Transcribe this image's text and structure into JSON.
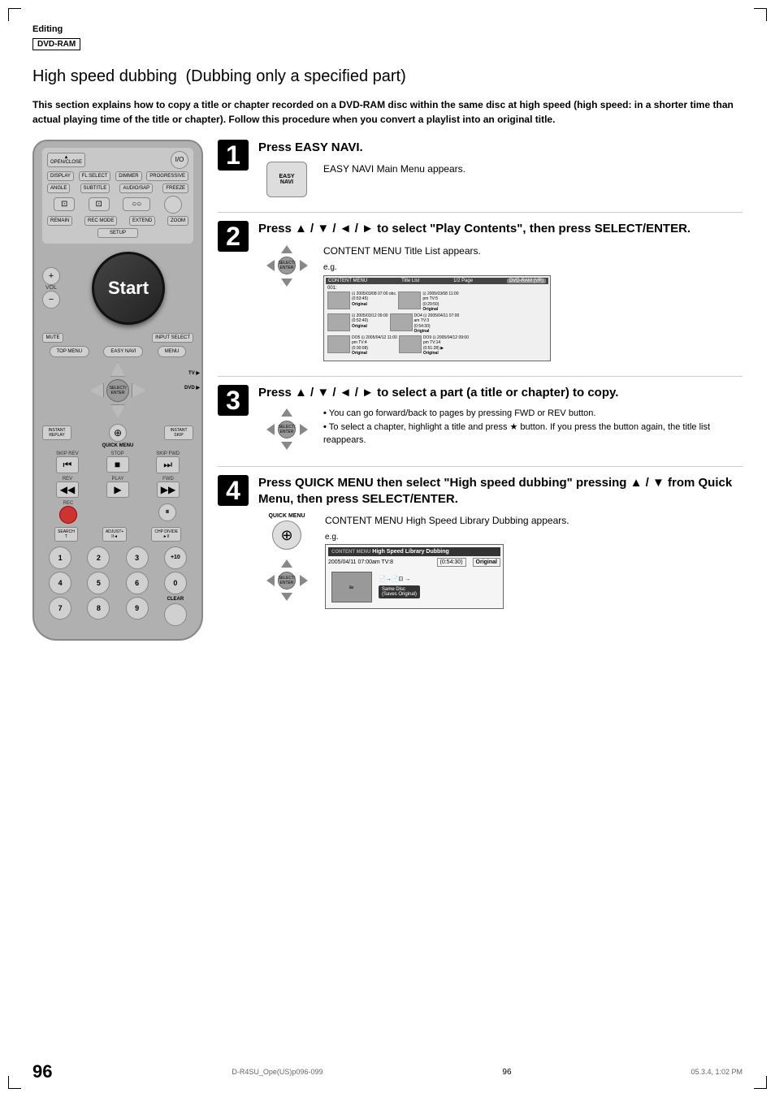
{
  "page": {
    "corner_marks": true,
    "section_label": "Editing",
    "dvd_ram_badge": "DVD-RAM",
    "title": "High speed dubbing",
    "subtitle": "(Dubbing only a specified part)",
    "description": "This section explains how to copy a title or chapter recorded on a DVD-RAM disc within the same disc at high speed (high speed: in a shorter time than actual playing time of the title or chapter). Follow this procedure when you convert a playlist into an original title."
  },
  "remote": {
    "start_label": "Start",
    "buttons": {
      "open_close": "OPEN/CLOSE",
      "power": "I/O",
      "display": "DISPLAY",
      "fl_select": "FL SELECT",
      "dimmer": "DIMMER",
      "progressive": "PROGRESSIVE",
      "angle": "ANGLE",
      "subtitle": "SUBTITLE",
      "audio_sap": "AUDIO/SAP",
      "freeze": "FREEZE",
      "remain": "REMAIN",
      "rec_mode": "REC MODE",
      "extend": "EXTEND",
      "zoom": "ZOOM",
      "setup": "SETUP",
      "vol_plus": "+",
      "vol_minus": "−",
      "mute": "MUTE",
      "input_select": "INPUT SELECT",
      "top_menu": "TOP MENU",
      "easy_navi": "EASY NAVI",
      "menu": "MENU",
      "select_enter": "SELECT/\nENTER",
      "tv": "TV",
      "dvd": "DVD",
      "instant_replay": "INSTANT\nREPLAY",
      "instant_skip": "INSTANT\nSKIP",
      "quick_menu": "QUICK MENU",
      "skip_rev": "SKIP REV",
      "stop": "STOP",
      "skip_fwd": "SKIP FWD",
      "rev": "REV",
      "play": "PLAY",
      "fwd": "FWD",
      "rec": "REC",
      "pause": "II",
      "search": "SEARCH\nT",
      "adjust": "ADJUST+\nII◄",
      "chp_divide": "CHP DIVIDE\n►II",
      "nums": [
        "1",
        "2",
        "3",
        "+10",
        "4",
        "5",
        "6",
        "0",
        "7",
        "8",
        "9",
        ""
      ],
      "clear": "CLEAR"
    }
  },
  "steps": [
    {
      "number": "1",
      "title": "Press EASY NAVI.",
      "description": "EASY NAVI Main Menu appears.",
      "button_label": "EASY\nNAVI"
    },
    {
      "number": "2",
      "title": "Press ▲ / ▼ / ◄ / ► to select \"Play Contents\", then press SELECT/ENTER.",
      "description": "CONTENT MENU Title List appears.",
      "eg_label": "e.g.",
      "screen": {
        "header_left": "CONTENT\nMENU",
        "header_mid": "Title List",
        "header_right": "1/2 Page",
        "header_badge": "DVD-RAM (VR)",
        "items": [
          {
            "id": "001",
            "date": "2005/03/08 07:00",
            "ch": "obc.",
            "time": "(0:53:45)",
            "label": "Original",
            "r_date": "2005/03/08 11:00",
            "r_ch": "pm TV:5",
            "r_time": "(0:29:50)",
            "r_label": "Original"
          },
          {
            "id": "",
            "date": "2005/03/12 09:00",
            "ch": "",
            "time": "(0:52:40)",
            "label": "Original",
            "r_id": "DO4",
            "r_date": "2005/04/11 07:00",
            "r_ch": "am TV:3",
            "r_time": "(0:54:30)",
            "r_label": "Original"
          },
          {
            "id": "DO5",
            "date": "2005/04/12 11:00",
            "ch": "pm TV:4",
            "time": "(0:30:08)",
            "label": "Original",
            "r_id": "DO9",
            "r_date": "2005/04/12 09:00",
            "r_ch": "pm TV:14",
            "r_time": "(0:51:28)",
            "r_label": "Original"
          }
        ]
      }
    },
    {
      "number": "3",
      "title": "Press ▲ / ▼ / ◄ / ► to select a part (a title or chapter) to copy.",
      "bullets": [
        "You can go forward/back to pages by pressing FWD or REV button.",
        "To select a chapter, highlight a title and press ★ button. If you press the button again, the title list reappears."
      ]
    },
    {
      "number": "4",
      "title": "Press QUICK MENU then select \"High speed dubbing\" pressing ▲ / ▼ from Quick Menu, then press SELECT/ENTER.",
      "description": "CONTENT MENU High Speed Library Dubbing appears.",
      "eg_label": "e.g.",
      "quick_menu_label": "QUICK MENU",
      "screen": {
        "header": "High Speed Library Dubbing",
        "row_date": "2005/04/11 07:00am TV:8",
        "row_time": "(0:54:30)",
        "row_label": "Original",
        "copy_label": "Same Disc\n(Saves Original)"
      }
    }
  ],
  "footer": {
    "page_number": "96",
    "model": "D-R4SU_Ope(US)p096-099",
    "page_ref": "96",
    "date": "05.3.4, 1:02 PM"
  }
}
